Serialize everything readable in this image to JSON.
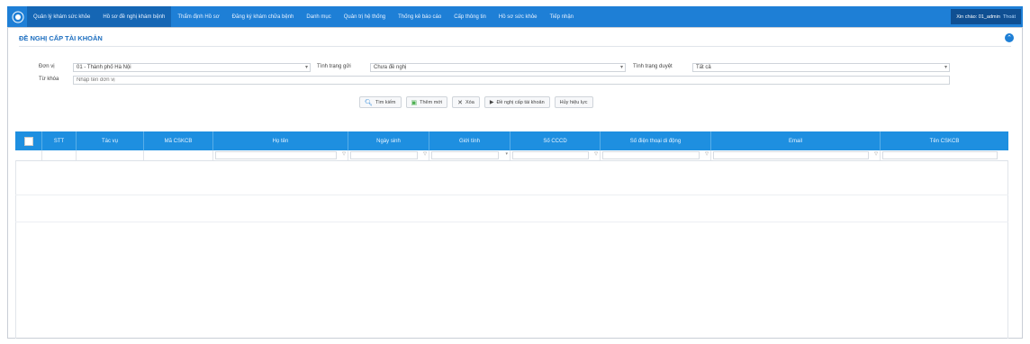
{
  "topnav": {
    "items": [
      {
        "label": "Quản lý khám sức khỏe"
      },
      {
        "label": "Hồ sơ đề nghị khám bệnh"
      },
      {
        "label": "Thẩm định Hồ sơ"
      },
      {
        "label": "Đăng ký khám chữa bệnh"
      },
      {
        "label": "Danh mục"
      },
      {
        "label": "Quản trị hệ thống"
      },
      {
        "label": "Thống kê báo cáo"
      },
      {
        "label": "Cấp thông tin"
      },
      {
        "label": "Hồ sơ sức khỏe"
      },
      {
        "label": "Tiếp nhận"
      }
    ],
    "user": "Xin chào: 01_admin",
    "logout": "Thoát"
  },
  "panel": {
    "title": "ĐỀ NGHỊ CẤP TÀI KHOẢN"
  },
  "filters": {
    "unit_label": "Đơn vị",
    "unit_value": "01 - Thành phố Hà Nội",
    "status_request_label": "Tình trạng gửi",
    "status_request_value": "Chưa đề nghị",
    "status_approve_label": "Tình trạng duyệt",
    "status_approve_value": "Tất cả",
    "keyword_label": "Từ khóa",
    "keyword_placeholder": "Nhập tên đơn vị"
  },
  "toolbar": {
    "search": "Tìm kiếm",
    "add": "Thêm mới",
    "delete": "Xóa",
    "request": "Đề nghị cấp tài khoản",
    "cancel_request": "Hủy hiệu lực"
  },
  "grid": {
    "columns": [
      "STT",
      "Tác vụ",
      "Mã CSKCB",
      "Họ tên",
      "Ngày sinh",
      "Giới tính",
      "Số CCCD",
      "Số điện thoại di động",
      "Email",
      "Tên CSKCB"
    ]
  },
  "colors": {
    "nav_bg": "#1e7fd6",
    "grid_header": "#1e8fe0",
    "title": "#1e6fc0"
  }
}
